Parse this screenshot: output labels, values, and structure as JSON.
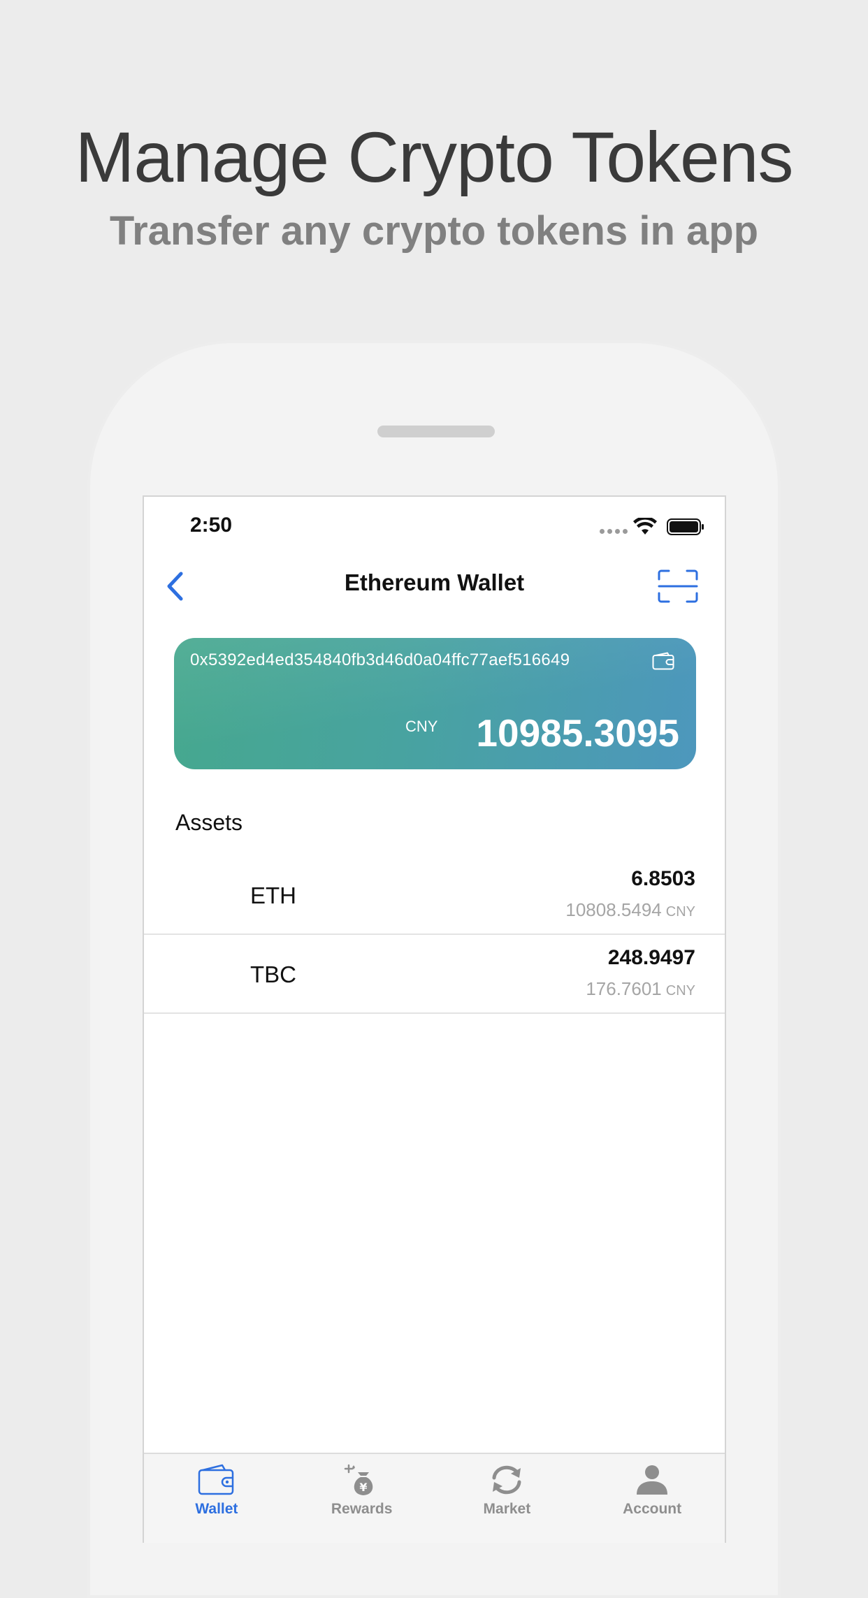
{
  "promo": {
    "headline": "Manage Crypto Tokens",
    "subline": "Transfer any crypto tokens in app"
  },
  "status_bar": {
    "time": "2:50"
  },
  "nav": {
    "title": "Ethereum Wallet",
    "back_icon": "chevron-left-icon",
    "scan_icon": "scan-qr-icon"
  },
  "wallet_card": {
    "address": "0x5392ed4ed354840fb3d46d0a04ffc77aef516649",
    "currency": "CNY",
    "balance": "10985.3095"
  },
  "assets": {
    "heading": "Assets",
    "items": [
      {
        "symbol": "ETH",
        "amount": "6.8503",
        "value": "10808.5494",
        "unit": "CNY"
      },
      {
        "symbol": "TBC",
        "amount": "248.9497",
        "value": "176.7601",
        "unit": "CNY"
      }
    ]
  },
  "tab_bar": {
    "items": [
      {
        "label": "Wallet",
        "icon": "wallet-icon",
        "active": true
      },
      {
        "label": "Rewards",
        "icon": "money-bag-icon",
        "active": false
      },
      {
        "label": "Market",
        "icon": "refresh-icon",
        "active": false
      },
      {
        "label": "Account",
        "icon": "person-icon",
        "active": false
      }
    ]
  },
  "colors": {
    "accent": "#2d6fe0",
    "card_gradient_start": "#46a88e",
    "card_gradient_end": "#4d97bd",
    "muted_text": "#a5a5a5"
  }
}
